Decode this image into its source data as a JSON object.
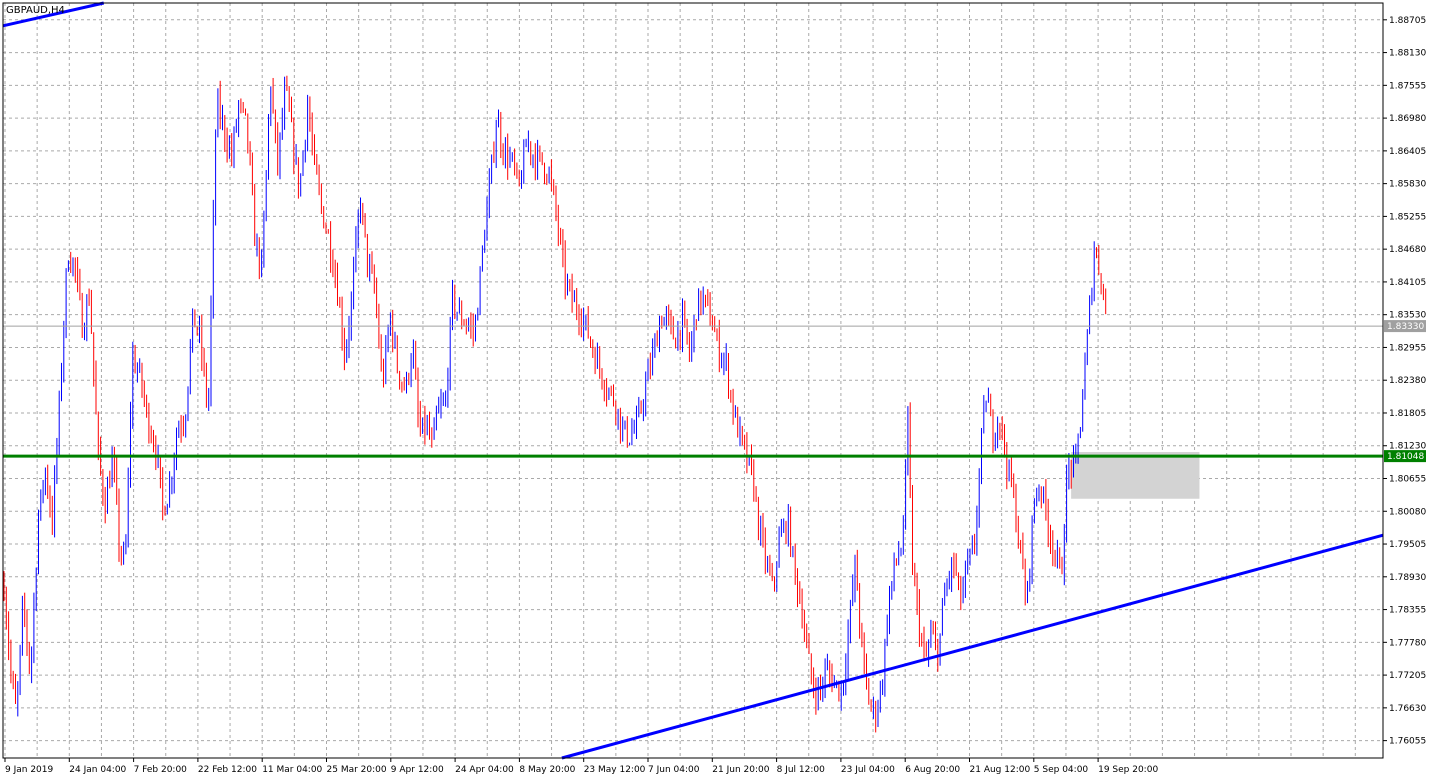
{
  "chart_data": {
    "type": "candlestick",
    "symbol_label": "GBPAUD,H4",
    "ylim": [
      1.7575,
      1.89
    ],
    "y_ticks": [
      "1.88705",
      "1.88130",
      "1.87555",
      "1.86980",
      "1.86405",
      "1.85830",
      "1.85255",
      "1.84680",
      "1.84105",
      "1.83530",
      "1.82955",
      "1.82380",
      "1.81805",
      "1.81230",
      "1.80655",
      "1.80080",
      "1.79505",
      "1.78930",
      "1.78355",
      "1.77780",
      "1.77205",
      "1.76630",
      "1.76055"
    ],
    "x_ticks": [
      "9 Jan 2019",
      "24 Jan 04:00",
      "7 Feb 20:00",
      "22 Feb 12:00",
      "11 Mar 04:00",
      "25 Mar 20:00",
      "9 Apr 12:00",
      "24 Apr 04:00",
      "8 May 20:00",
      "23 May 12:00",
      "7 Jun 04:00",
      "21 Jun 20:00",
      "8 Jul 12:00",
      "23 Jul 04:00",
      "6 Aug 20:00",
      "21 Aug 12:00",
      "5 Sep 04:00",
      "19 Sep 20:00"
    ],
    "grid": true,
    "current_price": {
      "label": "1.83330",
      "value": 1.8333
    },
    "support_level": {
      "label": "1.81048",
      "value": 1.81048,
      "color": "#008000"
    },
    "trendlines": [
      {
        "name": "upper-trendline",
        "color": "#0000ff",
        "from": [
          0.0,
          1.886
        ],
        "to": [
          0.073,
          1.89
        ]
      },
      {
        "name": "lower-trendline",
        "color": "#0000ff",
        "from": [
          0.405,
          1.7575
        ],
        "to": [
          1.0,
          1.7966
        ]
      }
    ],
    "zone": {
      "x_from": 0.774,
      "x_to": 0.867,
      "y_top": 1.8112,
      "y_bottom": 1.803,
      "color": "#d3d3d3"
    },
    "up_color": "#0000ff",
    "down_color": "#ff0000",
    "price_path": [
      [
        0.0,
        1.788
      ],
      [
        0.005,
        1.772
      ],
      [
        0.009,
        1.765
      ],
      [
        0.014,
        1.785
      ],
      [
        0.019,
        1.772
      ],
      [
        0.025,
        1.8
      ],
      [
        0.03,
        1.808
      ],
      [
        0.035,
        1.799
      ],
      [
        0.04,
        1.819
      ],
      [
        0.046,
        1.846
      ],
      [
        0.051,
        1.844
      ],
      [
        0.057,
        1.833
      ],
      [
        0.062,
        1.839
      ],
      [
        0.068,
        1.811
      ],
      [
        0.073,
        1.802
      ],
      [
        0.079,
        1.81
      ],
      [
        0.084,
        1.793
      ],
      [
        0.088,
        1.792
      ],
      [
        0.093,
        1.828
      ],
      [
        0.099,
        1.824
      ],
      [
        0.104,
        1.817
      ],
      [
        0.11,
        1.812
      ],
      [
        0.115,
        1.801
      ],
      [
        0.12,
        1.805
      ],
      [
        0.126,
        1.816
      ],
      [
        0.131,
        1.817
      ],
      [
        0.137,
        1.835
      ],
      [
        0.142,
        1.831
      ],
      [
        0.148,
        1.818
      ],
      [
        0.154,
        1.873
      ],
      [
        0.159,
        1.868
      ],
      [
        0.165,
        1.863
      ],
      [
        0.17,
        1.872
      ],
      [
        0.176,
        1.868
      ],
      [
        0.182,
        1.848
      ],
      [
        0.187,
        1.843
      ],
      [
        0.193,
        1.877
      ],
      [
        0.198,
        1.861
      ],
      [
        0.204,
        1.875
      ],
      [
        0.209,
        1.866
      ],
      [
        0.214,
        1.857
      ],
      [
        0.22,
        1.872
      ],
      [
        0.225,
        1.861
      ],
      [
        0.23,
        1.854
      ],
      [
        0.236,
        1.848
      ],
      [
        0.241,
        1.841
      ],
      [
        0.247,
        1.828
      ],
      [
        0.252,
        1.838
      ],
      [
        0.258,
        1.856
      ],
      [
        0.263,
        1.845
      ],
      [
        0.269,
        1.839
      ],
      [
        0.274,
        1.823
      ],
      [
        0.28,
        1.835
      ],
      [
        0.285,
        1.826
      ],
      [
        0.291,
        1.822
      ],
      [
        0.296,
        1.83
      ],
      [
        0.301,
        1.814
      ],
      [
        0.306,
        1.816
      ],
      [
        0.31,
        1.812
      ],
      [
        0.314,
        1.818
      ],
      [
        0.32,
        1.82
      ],
      [
        0.325,
        1.838
      ],
      [
        0.33,
        1.835
      ],
      [
        0.335,
        1.834
      ],
      [
        0.341,
        1.832
      ],
      [
        0.347,
        1.847
      ],
      [
        0.352,
        1.858
      ],
      [
        0.357,
        1.87
      ],
      [
        0.362,
        1.864
      ],
      [
        0.368,
        1.862
      ],
      [
        0.373,
        1.857
      ],
      [
        0.379,
        1.866
      ],
      [
        0.384,
        1.863
      ],
      [
        0.39,
        1.862
      ],
      [
        0.395,
        1.86
      ],
      [
        0.4,
        1.853
      ],
      [
        0.406,
        1.842
      ],
      [
        0.411,
        1.838
      ],
      [
        0.417,
        1.836
      ],
      [
        0.422,
        1.833
      ],
      [
        0.427,
        1.829
      ],
      [
        0.433,
        1.825
      ],
      [
        0.438,
        1.822
      ],
      [
        0.443,
        1.82
      ],
      [
        0.448,
        1.815
      ],
      [
        0.453,
        1.814
      ],
      [
        0.459,
        1.816
      ],
      [
        0.465,
        1.823
      ],
      [
        0.47,
        1.828
      ],
      [
        0.476,
        1.835
      ],
      [
        0.481,
        1.834
      ],
      [
        0.486,
        1.831
      ],
      [
        0.492,
        1.834
      ],
      [
        0.497,
        1.828
      ],
      [
        0.502,
        1.837
      ],
      [
        0.507,
        1.838
      ],
      [
        0.513,
        1.834
      ],
      [
        0.518,
        1.829
      ],
      [
        0.523,
        1.827
      ],
      [
        0.528,
        1.819
      ],
      [
        0.533,
        1.814
      ],
      [
        0.538,
        1.81
      ],
      [
        0.543,
        1.806
      ],
      [
        0.547,
        1.798
      ],
      [
        0.552,
        1.792
      ],
      [
        0.557,
        1.787
      ],
      [
        0.562,
        1.796
      ],
      [
        0.568,
        1.799
      ],
      [
        0.573,
        1.79
      ],
      [
        0.578,
        1.784
      ],
      [
        0.582,
        1.776
      ],
      [
        0.586,
        1.77
      ],
      [
        0.591,
        1.769
      ],
      [
        0.596,
        1.773
      ],
      [
        0.601,
        1.771
      ],
      [
        0.607,
        1.769
      ],
      [
        0.612,
        1.78
      ],
      [
        0.617,
        1.792
      ],
      [
        0.621,
        1.778
      ],
      [
        0.626,
        1.768
      ],
      [
        0.631,
        1.765
      ],
      [
        0.636,
        1.77
      ],
      [
        0.641,
        1.785
      ],
      [
        0.646,
        1.792
      ],
      [
        0.651,
        1.795
      ],
      [
        0.655,
        1.816
      ],
      [
        0.658,
        1.792
      ],
      [
        0.662,
        1.783
      ],
      [
        0.667,
        1.774
      ],
      [
        0.672,
        1.779
      ],
      [
        0.677,
        1.776
      ],
      [
        0.682,
        1.787
      ],
      [
        0.688,
        1.792
      ],
      [
        0.693,
        1.785
      ],
      [
        0.698,
        1.791
      ],
      [
        0.703,
        1.794
      ],
      [
        0.708,
        1.812
      ],
      [
        0.712,
        1.822
      ],
      [
        0.716,
        1.814
      ],
      [
        0.721,
        1.818
      ],
      [
        0.726,
        1.81
      ],
      [
        0.731,
        1.804
      ],
      [
        0.736,
        1.795
      ],
      [
        0.741,
        1.784
      ],
      [
        0.746,
        1.802
      ],
      [
        0.751,
        1.806
      ],
      [
        0.756,
        1.799
      ],
      [
        0.761,
        1.794
      ],
      [
        0.766,
        1.789
      ],
      [
        0.771,
        1.809
      ],
      [
        0.776,
        1.808
      ],
      [
        0.781,
        1.819
      ],
      [
        0.786,
        1.834
      ],
      [
        0.79,
        1.847
      ],
      [
        0.795,
        1.842
      ],
      [
        0.8,
        1.833
      ]
    ]
  }
}
